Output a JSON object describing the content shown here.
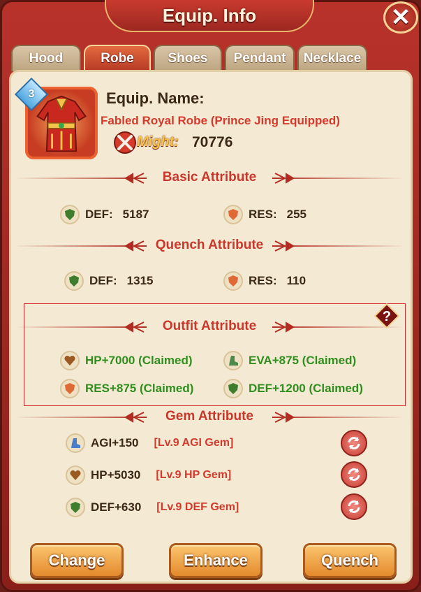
{
  "header": {
    "title": "Equip. Info",
    "close_label": "✕"
  },
  "tabs": [
    {
      "label": "Hood"
    },
    {
      "label": "Robe"
    },
    {
      "label": "Shoes"
    },
    {
      "label": "Pendant"
    },
    {
      "label": "Necklace"
    }
  ],
  "active_tab": "Robe",
  "equip": {
    "quality_level": "3",
    "name_label": "Equip. Name:",
    "name_value": "Fabled Royal Robe  (Prince Jing Equipped)",
    "might_label": "Might:",
    "might_value": "70776"
  },
  "basic": {
    "title": "Basic Attribute",
    "items": [
      {
        "label": "DEF:",
        "value": "5187",
        "icon": "def-shield-icon"
      },
      {
        "label": "RES:",
        "value": "255",
        "icon": "res-shield-icon"
      }
    ]
  },
  "quench": {
    "title": "Quench Attribute",
    "items": [
      {
        "label": "DEF:",
        "value": "1315",
        "icon": "def-shield-icon"
      },
      {
        "label": "RES:",
        "value": "110",
        "icon": "res-shield-icon"
      }
    ]
  },
  "outfit": {
    "title": "Outfit Attribute",
    "help_label": "?",
    "items": [
      {
        "text": "HP+7000 (Claimed)",
        "icon": "heart-icon"
      },
      {
        "text": "EVA+875 (Claimed)",
        "icon": "eva-boot-icon"
      },
      {
        "text": "RES+875 (Claimed)",
        "icon": "res-shield-icon"
      },
      {
        "text": "DEF+1200 (Claimed)",
        "icon": "def-shield-icon"
      }
    ]
  },
  "gem": {
    "title": "Gem Attribute",
    "items": [
      {
        "stat": "AGI+150",
        "desc": "[Lv.9 AGI Gem]",
        "icon": "agi-boot-icon"
      },
      {
        "stat": "HP+5030",
        "desc": "[Lv.9 HP Gem]",
        "icon": "heart-icon"
      },
      {
        "stat": "DEF+630",
        "desc": "[Lv.9 DEF Gem]",
        "icon": "def-shield-icon"
      }
    ]
  },
  "buttons": {
    "change": "Change",
    "enhance": "Enhance",
    "quench": "Quench"
  },
  "colors": {
    "frame": "#b8322a",
    "panel": "#f4ead3",
    "section_title": "#c8382c",
    "claimed_green": "#2f8e1e",
    "gem_red": "#d23a2c",
    "button_orange": "#e48a2e"
  }
}
